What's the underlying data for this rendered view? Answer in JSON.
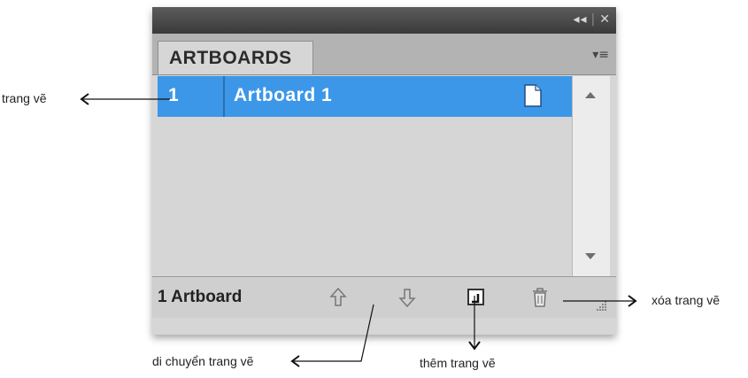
{
  "panel": {
    "title_controls": {
      "collapse_glyph": "◂◂",
      "close_glyph": "✕"
    },
    "tab_label": "ARTBOARDS",
    "panel_menu_glyph": "▾≡",
    "rows": [
      {
        "number": "1",
        "name": "Artboard 1",
        "icon": "document-icon"
      }
    ],
    "footer": {
      "count_label": "1 Artboard"
    }
  },
  "annotations": {
    "artboard_row": "trang vẽ",
    "move": "di chuyển trang vẽ",
    "new": "thêm trang vẽ",
    "delete": "xóa trang vẽ"
  },
  "colors": {
    "selected_row": "#3d97e8",
    "panel_bg": "#d6d6d6",
    "titlebar": "#3a3a3a"
  }
}
